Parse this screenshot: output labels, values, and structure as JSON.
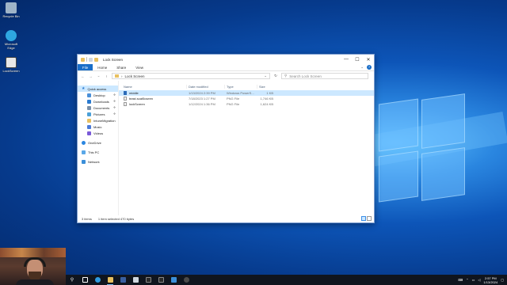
{
  "desktop": {
    "icons": [
      {
        "label": "Recycle Bin",
        "color": "#9fb4c8"
      },
      {
        "label": "Microsoft Edge",
        "color": "#2ea7e0"
      },
      {
        "label": "LockScreen",
        "color": "#e8e8e8"
      }
    ]
  },
  "window": {
    "title": "Lock Screen",
    "ribbon_tabs": [
      "File",
      "Home",
      "Share",
      "View"
    ],
    "controls": {
      "minimize": "—",
      "maximize": "☐",
      "close": "✕"
    },
    "address": {
      "path": "Lock Screen"
    },
    "search": {
      "placeholder": "Search Lock Screen"
    },
    "nav": {
      "quick_access": "Quick access",
      "items": [
        {
          "label": "Desktop",
          "pinned": true,
          "color": "#4a90d9"
        },
        {
          "label": "Downloads",
          "pinned": true,
          "color": "#2a7ad0"
        },
        {
          "label": "Documents",
          "pinned": true,
          "color": "#7a8fa8"
        },
        {
          "label": "Pictures",
          "pinned": true,
          "color": "#4aa0d8"
        },
        {
          "label": "IntuneMigration",
          "pinned": false,
          "color": "#e8c060"
        },
        {
          "label": "Music",
          "pinned": false,
          "color": "#4a7ad8"
        },
        {
          "label": "Videos",
          "pinned": false,
          "color": "#7a5ad8"
        }
      ],
      "onedrive": "OneDrive",
      "this_pc": "This PC",
      "network": "Network"
    },
    "columns": {
      "name": "Name",
      "date": "Date modified",
      "type": "Type",
      "size": "Size"
    },
    "files": [
      {
        "name": "middle",
        "date": "1/13/2024 2:39 PM",
        "type": "Windows PowerS...",
        "size": "1 KB",
        "selected": true,
        "icon": "powershell-file-icon"
      },
      {
        "name": "teast.scat5cseen",
        "date": "7/18/2023 1:27 PM",
        "type": "PNG File",
        "size": "1,746 KB",
        "selected": false,
        "icon": "png-file-icon"
      },
      {
        "name": "lockScreen",
        "date": "1/12/2024 1:36 PM",
        "type": "PNG File",
        "size": "1,624 KB",
        "selected": false,
        "icon": "png-file-icon"
      }
    ],
    "status": {
      "items": "3 items",
      "selection": "1 item selected  470 bytes"
    }
  },
  "taskbar": {
    "apps": [
      "#2f9be0",
      "#e8c060",
      "#3a5fa0",
      "#cfd6de",
      "#2a2a2a",
      "#2a2a2a",
      "#3b8fd9",
      "#4a4a4a"
    ],
    "time": "2:57 PM",
    "date": "1/13/2024"
  }
}
